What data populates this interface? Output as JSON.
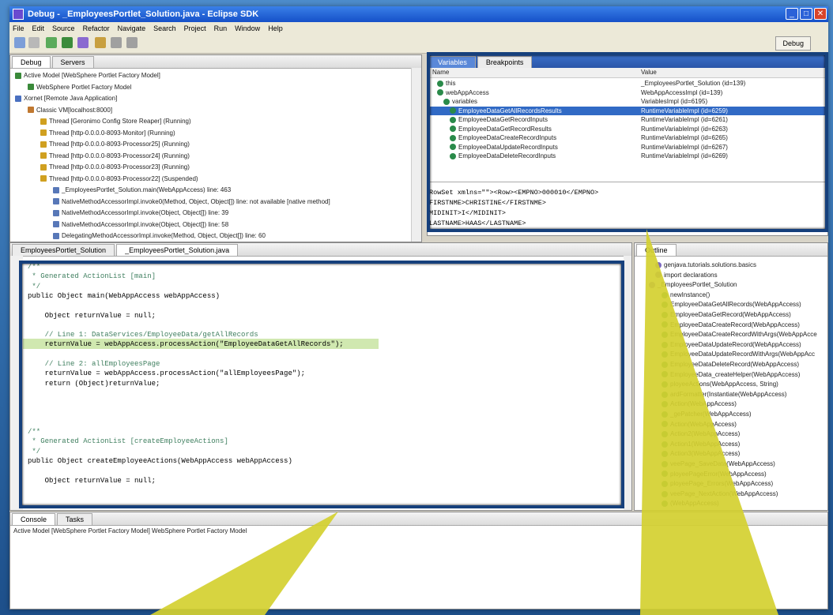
{
  "window": {
    "title": "Debug - _EmployeesPortlet_Solution.java - Eclipse SDK",
    "menu": [
      "File",
      "Edit",
      "Source",
      "Refactor",
      "Navigate",
      "Search",
      "Project",
      "Run",
      "Window",
      "Help"
    ],
    "perspective": "Debug"
  },
  "debug_view": {
    "tabs": [
      "Debug",
      "Servers"
    ],
    "rows": [
      {
        "text": "Active Model [WebSphere Portlet Factory Model]",
        "indent": 0,
        "icon": "model-icon"
      },
      {
        "text": "WebSphere Portlet Factory Model",
        "indent": 2,
        "icon": "model-icon"
      },
      {
        "text": "Xornet [Remote Java Application]",
        "indent": 0,
        "icon": "app-icon"
      },
      {
        "text": "Classic VM[localhost:8000]",
        "indent": 2,
        "icon": "vm-icon"
      },
      {
        "text": "Thread [Geronimo Config Store Reaper] (Running)",
        "indent": 4,
        "icon": "thread-icon"
      },
      {
        "text": "Thread [http-0.0.0.0-8093-Monitor] (Running)",
        "indent": 4,
        "icon": "thread-icon"
      },
      {
        "text": "Thread [http-0.0.0.0-8093-Processor25] (Running)",
        "indent": 4,
        "icon": "thread-icon"
      },
      {
        "text": "Thread [http-0.0.0.0-8093-Processor24] (Running)",
        "indent": 4,
        "icon": "thread-icon"
      },
      {
        "text": "Thread [http-0.0.0.0-8093-Processor23] (Running)",
        "indent": 4,
        "icon": "thread-icon"
      },
      {
        "text": "Thread [http-0.0.0.0-8093-Processor22] (Suspended)",
        "indent": 4,
        "icon": "thread-icon"
      },
      {
        "text": "_EmployeesPortlet_Solution.main(WebAppAccess) line: 463",
        "indent": 6,
        "icon": "frame-icon"
      },
      {
        "text": "NativeMethodAccessorImpl.invoke0(Method, Object, Object[]) line: not available [native method]",
        "indent": 6,
        "icon": "frame-icon"
      },
      {
        "text": "NativeMethodAccessorImpl.invoke(Object, Object[]) line: 39",
        "indent": 6,
        "icon": "frame-icon"
      },
      {
        "text": "NativeMethodAccessorImpl.invoke(Object, Object[]) line: 58",
        "indent": 6,
        "icon": "frame-icon"
      },
      {
        "text": "DelegatingMethodAccessorImpl.invoke(Method, Object, Object[]) line: 60",
        "indent": 6,
        "icon": "frame-icon"
      }
    ]
  },
  "variables_view": {
    "tabs": [
      "Variables",
      "Breakpoints"
    ],
    "col_name": "Name",
    "col_value": "Value",
    "rows": [
      {
        "name": "this",
        "value": "_EmployeesPortlet_Solution (id=139)",
        "indent": 1,
        "selected": false
      },
      {
        "name": "webAppAccess",
        "value": "WebAppAccessImpl (id=139)",
        "indent": 1,
        "selected": false
      },
      {
        "name": "variables",
        "value": "VariablesImpl (id=6195)",
        "indent": 2,
        "selected": false
      },
      {
        "name": "EmployeeDataGetAllRecordsResults",
        "value": "RuntimeVariableImpl (id=6259)",
        "indent": 3,
        "selected": true
      },
      {
        "name": "EmployeeDataGetRecordInputs",
        "value": "RuntimeVariableImpl (id=6261)",
        "indent": 3,
        "selected": false
      },
      {
        "name": "EmployeeDataGetRecordResults",
        "value": "RuntimeVariableImpl (id=6263)",
        "indent": 3,
        "selected": false
      },
      {
        "name": "EmployeeDataCreateRecordInputs",
        "value": "RuntimeVariableImpl (id=6265)",
        "indent": 3,
        "selected": false
      },
      {
        "name": "EmployeeDataUpdateRecordInputs",
        "value": "RuntimeVariableImpl (id=6267)",
        "indent": 3,
        "selected": false
      },
      {
        "name": "EmployeeDataDeleteRecordInputs",
        "value": "RuntimeVariableImpl (id=6269)",
        "indent": 3,
        "selected": false
      }
    ],
    "detail_lines": [
      "RowSet xmlns=\"\"><Row><EMPNO>000010</EMPNO>",
      "FIRSTNME>CHRISTINE</FIRSTNME>",
      "MIDINIT>I</MIDINIT>",
      "LASTNAME>HAAS</LASTNAME>"
    ]
  },
  "editor": {
    "tabs": [
      "EmployeesPortlet_Solution",
      "_EmployeesPortlet_Solution.java"
    ],
    "lines": [
      {
        "t": "/**",
        "c": "cm"
      },
      {
        "t": " * Generated ActionList [main]",
        "c": "cm"
      },
      {
        "t": " */",
        "c": "cm"
      },
      {
        "t": "public Object main(WebAppAccess webAppAccess)",
        "c": "pl"
      },
      {
        "t": "",
        "c": "pl"
      },
      {
        "t": "    Object returnValue = null;",
        "c": "pl"
      },
      {
        "t": "",
        "c": "pl"
      },
      {
        "t": "    // Line 1: DataServices/EmployeeData/getAllRecords",
        "c": "cm"
      },
      {
        "t": "    returnValue = webAppAccess.processAction(\"EmployeeDataGetAllRecords\");",
        "c": "hl"
      },
      {
        "t": "",
        "c": "pl"
      },
      {
        "t": "    // Line 2: allEmployeesPage",
        "c": "cm"
      },
      {
        "t": "    returnValue = webAppAccess.processAction(\"allEmployeesPage\");",
        "c": "pl"
      },
      {
        "t": "    return (Object)returnValue;",
        "c": "pl"
      },
      {
        "t": "",
        "c": "pl"
      },
      {
        "t": "",
        "c": "pl"
      },
      {
        "t": "",
        "c": "pl"
      },
      {
        "t": "",
        "c": "pl"
      },
      {
        "t": "/**",
        "c": "cm"
      },
      {
        "t": " * Generated ActionList [createEmployeeActions]",
        "c": "cm"
      },
      {
        "t": " */",
        "c": "cm"
      },
      {
        "t": "public Object createEmployeeActions(WebAppAccess webAppAccess)",
        "c": "pl"
      },
      {
        "t": "",
        "c": "pl"
      },
      {
        "t": "    Object returnValue = null;",
        "c": "pl"
      }
    ]
  },
  "outline_view": {
    "tab": "Outline",
    "rows": [
      "genjava.tutorials.solutions.basics",
      "import declarations",
      "_EmployeesPortlet_Solution",
      "newInstance()",
      "EmployeeDataGetAllRecords(WebAppAccess)",
      "EmployeeDataGetRecord(WebAppAccess)",
      "EmployeeDataCreateRecord(WebAppAccess)",
      "EmployeeDataCreateRecordWithArgs(WebAppAcce",
      "EmployeeDataUpdateRecord(WebAppAccess)",
      "EmployeeDataUpdateRecordWithArgs(WebAppAcc",
      "EmployeeDataDeleteRecord(WebAppAccess)",
      "EmployeeData_createHelper(WebAppAccess)",
      "ployeeActions(WebAppAccess, String)",
      "ardFormatter(Instantiate(WebAppAccess)",
      "Action(WebAppAccess)",
      "_gePatcher(WebAppAccess)",
      "Action(WebAppAccess)",
      "Action2(WebAppAccess)",
      "Action1(WebAppAccess)",
      "Action3(WebAppAccess)",
      "veePage_SaveData(WebAppAccess)",
      "ployeePageError(WebAppAccess)",
      "ployeePage_Errors(WebAppAccess)",
      "veePage_NextAction(WebAppAccess)",
      "(WebAppAccess)"
    ]
  },
  "console_view": {
    "tabs": [
      "Console",
      "Tasks"
    ],
    "text": "Active Model [WebSphere Portlet Factory Model] WebSphere Portlet Factory Model"
  },
  "colors": {
    "callout_border": "#16407c",
    "arrow": "#d4d030",
    "selection": "#316ac5"
  }
}
